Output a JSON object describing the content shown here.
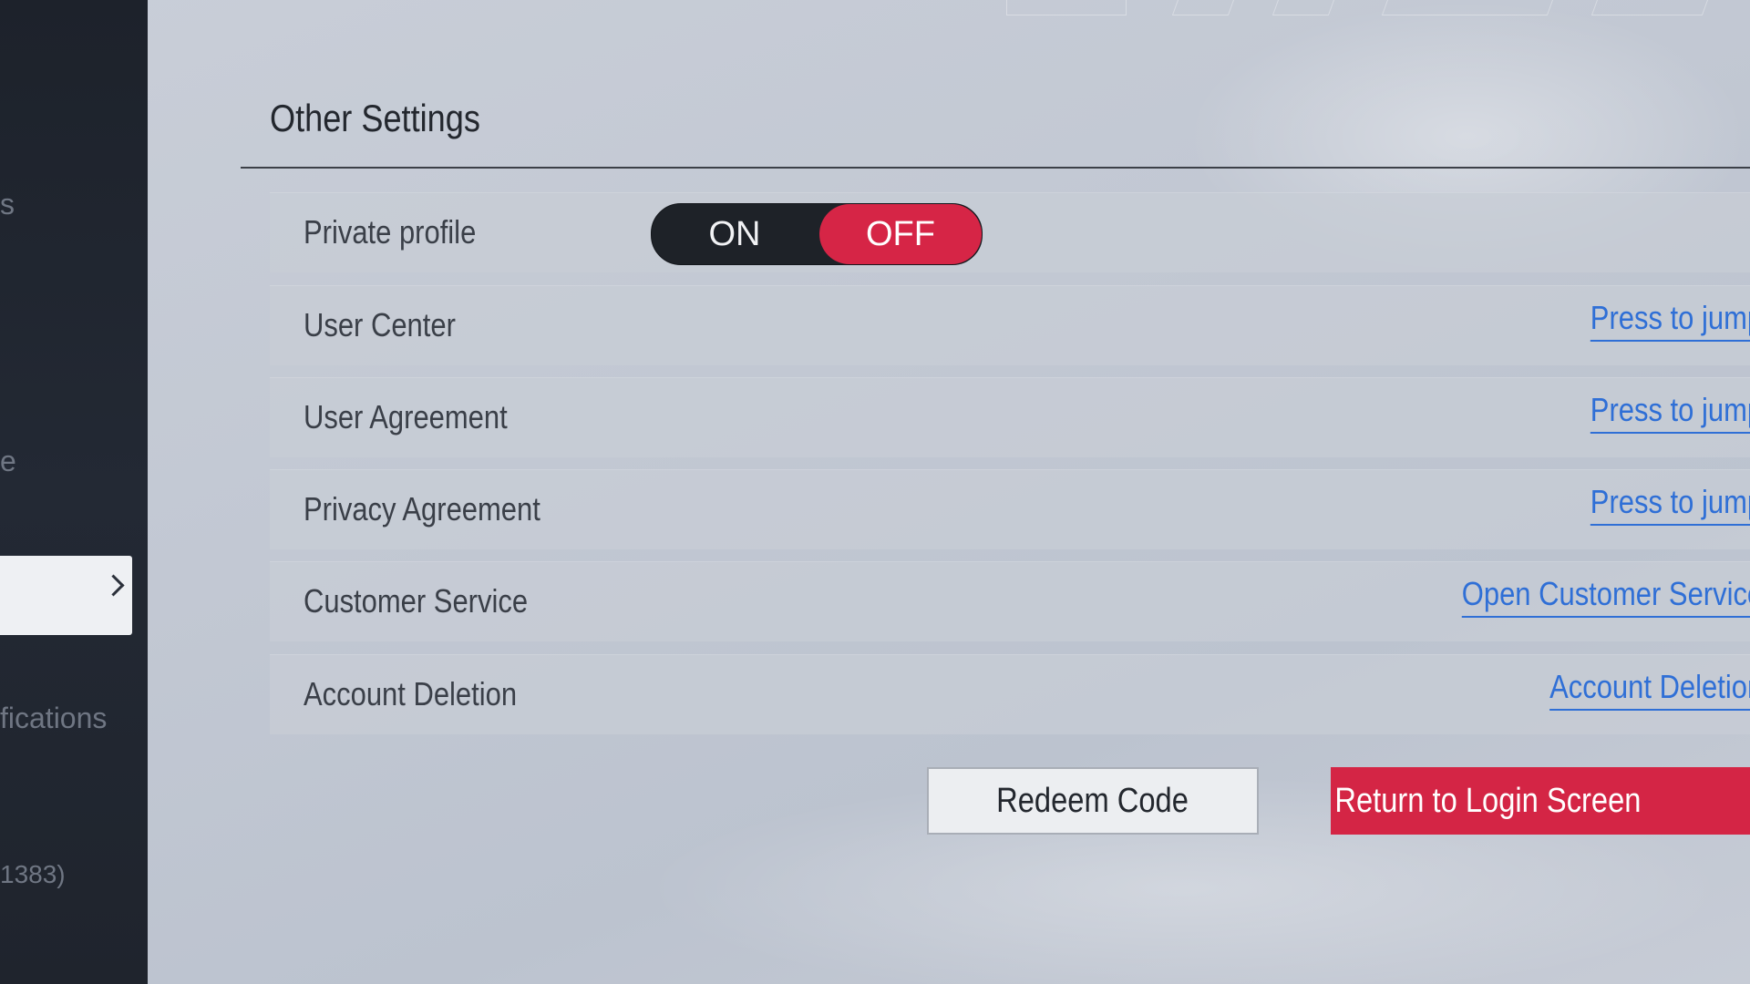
{
  "sidebar": {
    "items": [
      {
        "label": "s"
      },
      {
        "label": "e"
      },
      {
        "label": "",
        "active": true
      },
      {
        "label": "fications"
      },
      {
        "label": "1383)"
      }
    ]
  },
  "panel": {
    "title": "Other Settings",
    "rows": [
      {
        "label": "Private profile",
        "control": "toggle"
      },
      {
        "label": "User Center",
        "link": "Press to jump"
      },
      {
        "label": "User Agreement",
        "link": "Press to jump"
      },
      {
        "label": "Privacy Agreement",
        "link": "Press to jump"
      },
      {
        "label": "Customer Service",
        "link": "Open Customer Service"
      },
      {
        "label": "Account Deletion",
        "link": "Account Deletion"
      }
    ],
    "toggle": {
      "on_label": "ON",
      "off_label": "OFF",
      "selected": "OFF"
    }
  },
  "actions": {
    "redeem_label": "Redeem Code",
    "return_label": "Return to Login Screen"
  },
  "colors": {
    "accent_red": "#d62546",
    "link_blue": "#2f6fd6",
    "sidebar_bg": "#1f242d"
  },
  "icons": {
    "active_item": "chevron-right-icon"
  }
}
